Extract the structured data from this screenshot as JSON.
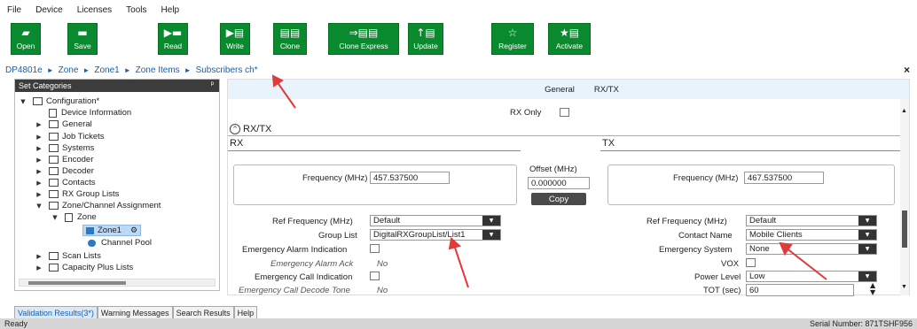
{
  "menu": [
    "File",
    "Device",
    "Licenses",
    "Tools",
    "Help"
  ],
  "toolbar": {
    "open": {
      "label": "Open",
      "icon": "▰"
    },
    "save": {
      "label": "Save",
      "icon": "▬"
    },
    "read": {
      "label": "Read",
      "icon": "▶▬"
    },
    "write": {
      "label": "Write",
      "icon": "▶▤"
    },
    "clone": {
      "label": "Clone",
      "icon": "▤▤"
    },
    "clone_express": {
      "label": "Clone Express",
      "icon": "⇒▤▤"
    },
    "update": {
      "label": "Update",
      "icon": "↑▤"
    },
    "register": {
      "label": "Register",
      "icon": "☆"
    },
    "activate": {
      "label": "Activate",
      "icon": "★▤"
    }
  },
  "breadcrumb": [
    "DP4801e",
    "Zone",
    "Zone1",
    "Zone Items",
    "Subscribers ch*"
  ],
  "breadcrumb_sep": "►",
  "left_panel": {
    "title": "Set Categories",
    "pin": "ᵖ",
    "tree": [
      {
        "label": "Configuration*"
      },
      {
        "label": "Device Information"
      },
      {
        "label": "General"
      },
      {
        "label": "Job Tickets"
      },
      {
        "label": "Systems"
      },
      {
        "label": "Encoder"
      },
      {
        "label": "Decoder"
      },
      {
        "label": "Contacts"
      },
      {
        "label": "RX Group Lists"
      },
      {
        "label": "Zone/Channel Assignment"
      },
      {
        "label": "Zone"
      },
      {
        "label": "Zone1"
      },
      {
        "label": "Channel Pool"
      },
      {
        "label": "Scan Lists"
      },
      {
        "label": "Capacity Plus Lists"
      }
    ]
  },
  "right_panel": {
    "tabs": [
      "General",
      "RX/TX"
    ],
    "rx_only_label": "RX Only",
    "section_title": "RX/TX",
    "rx_header": "RX",
    "tx_header": "TX",
    "rx_frequency_label": "Frequency (MHz)",
    "rx_frequency": "457.537500",
    "offset_label": "Offset (MHz)",
    "offset_value": "0.000000",
    "copy_label": "Copy",
    "tx_frequency_label": "Frequency (MHz)",
    "tx_frequency": "467.537500",
    "rx_ref_freq_label": "Ref Frequency (MHz)",
    "rx_ref_freq": "Default",
    "group_list_label": "Group List",
    "group_list": "DigitalRXGroupList/List1",
    "emergency_alarm_indication_label": "Emergency Alarm Indication",
    "emergency_alarm_ack_label": "Emergency Alarm Ack",
    "emergency_alarm_ack_value": "No",
    "emergency_call_indication_label": "Emergency Call Indication",
    "emergency_call_decode_tone_label": "Emergency Call Decode Tone",
    "emergency_call_decode_tone_value": "No",
    "tx_ref_freq_label": "Ref Frequency (MHz)",
    "tx_ref_freq": "Default",
    "contact_name_label": "Contact Name",
    "contact_name": "Mobile Clients",
    "emergency_system_label": "Emergency System",
    "emergency_system": "None",
    "vox_label": "VOX",
    "power_level_label": "Power Level",
    "power_level": "Low",
    "tot_label": "TOT (sec)",
    "tot_value": "60"
  },
  "bottom_tabs": [
    "Validation Results(3*)",
    "Warning Messages",
    "Search Results",
    "Help"
  ],
  "status": {
    "left": "Ready",
    "right": "Serial Number: 871TSHF956"
  },
  "colors": {
    "toolbar_green": "#0a8a2e",
    "link_blue": "#1a5fa8",
    "annotation_red": "#e03a3a"
  }
}
